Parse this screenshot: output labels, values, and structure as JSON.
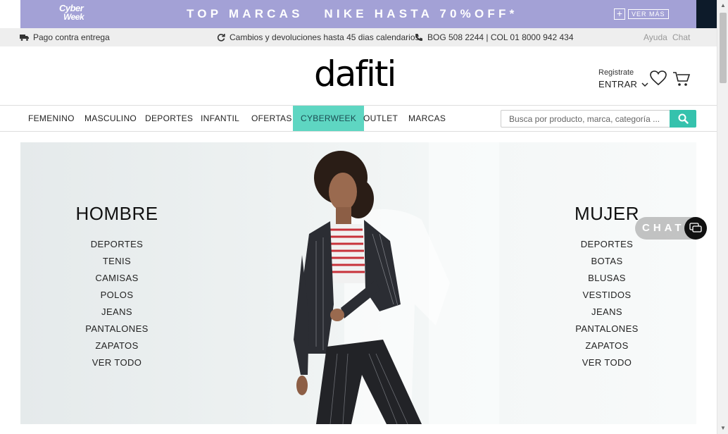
{
  "promo": {
    "logo_line1": "Cyber",
    "logo_line2": "Week",
    "text": "TOP MARCAS   NIKE HASTA 70%OFF*",
    "ver_mas": "VER MÁS",
    "plus": "+"
  },
  "util": {
    "pago": "Pago contra entrega",
    "cambios": "Cambios y devoluciones hasta 45 dias calendarios",
    "phone": "BOG 508 2244 | COL 01 8000 942 434",
    "ayuda": "Ayuda",
    "chat": "Chat"
  },
  "header": {
    "logo": "dafiti",
    "registrate": "Registrate",
    "entrar": "ENTRAR"
  },
  "nav": {
    "items": [
      "FEMENINO",
      "MASCULINO",
      "DEPORTES",
      "INFANTIL",
      "OFERTAS",
      "CYBERWEEK",
      "OUTLET",
      "MARCAS"
    ],
    "active": "CYBERWEEK",
    "search_placeholder": "Busca por producto, marca, categoría ..."
  },
  "hero": {
    "hombre": {
      "title": "HOMBRE",
      "links": [
        "DEPORTES",
        "TENIS",
        "CAMISAS",
        "POLOS",
        "JEANS",
        "PANTALONES",
        "ZAPATOS",
        "VER TODO"
      ]
    },
    "mujer": {
      "title": "MUJER",
      "links": [
        "DEPORTES",
        "BOTAS",
        "BLUSAS",
        "VESTIDOS",
        "JEANS",
        "PANTALONES",
        "ZAPATOS",
        "VER TODO"
      ]
    }
  },
  "chat_widget": {
    "label": "CHAT"
  },
  "colors": {
    "promo_bg": "#a3a1d6",
    "accent": "#35c2ad",
    "nav_active": "#5ed6c2",
    "util_bg": "#eeeeee"
  }
}
